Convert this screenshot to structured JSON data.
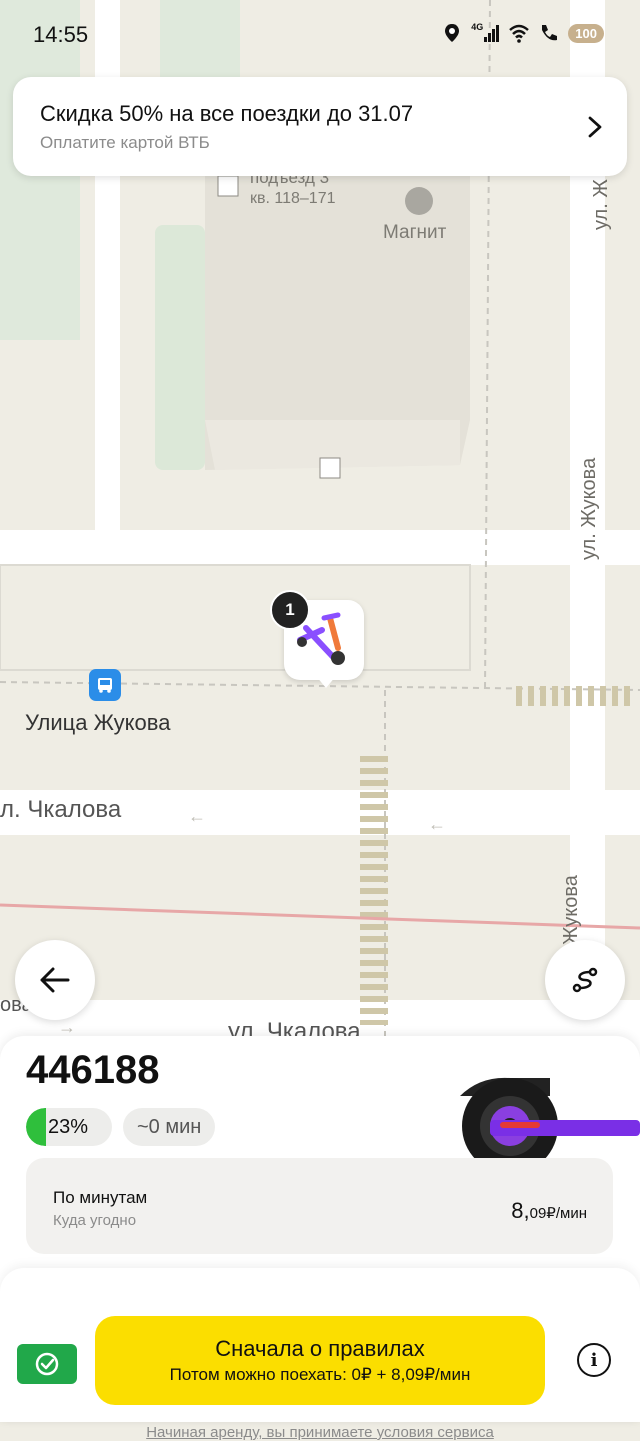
{
  "status_bar": {
    "time": "14:55",
    "network": "4G",
    "battery": "100"
  },
  "promo": {
    "title": "Скидка 50% на все поездки до 31.07",
    "subtitle": "Оплатите картой ВТБ"
  },
  "map": {
    "labels": {
      "entrance": "подъезд 3",
      "apartments": "кв. 118–171",
      "shop": "Магнит",
      "stop": "Улица Жукова",
      "street_chkalova_1": "л. Чкалова",
      "street_chkalova_2": "ул. Чкалова",
      "street_chkalova_left": "ова",
      "street_zhukova_1": "ул. Жукова",
      "street_zhukova_2": "Жукова",
      "street_top_right": "ул. Ж"
    },
    "marker_count": "1"
  },
  "scooter": {
    "id": "446188",
    "charge_label": "23%",
    "charge_percent": 23,
    "eta": "~0 мин"
  },
  "tariff": {
    "name": "По минутам",
    "description": "Куда угодно",
    "price_main": "8,",
    "price_small": "09₽/мин"
  },
  "actions": {
    "main_title": "Сначала о правилах",
    "main_subtitle": "Потом можно поехать: 0₽ + 8,09₽/мин",
    "terms": "Начиная аренду, вы принимаете условия сервиса"
  },
  "colors": {
    "accent_yellow": "#fbde00",
    "charge_green": "#2fbf3c",
    "shield_green": "#21a84a",
    "stop_blue": "#2b8de8"
  }
}
